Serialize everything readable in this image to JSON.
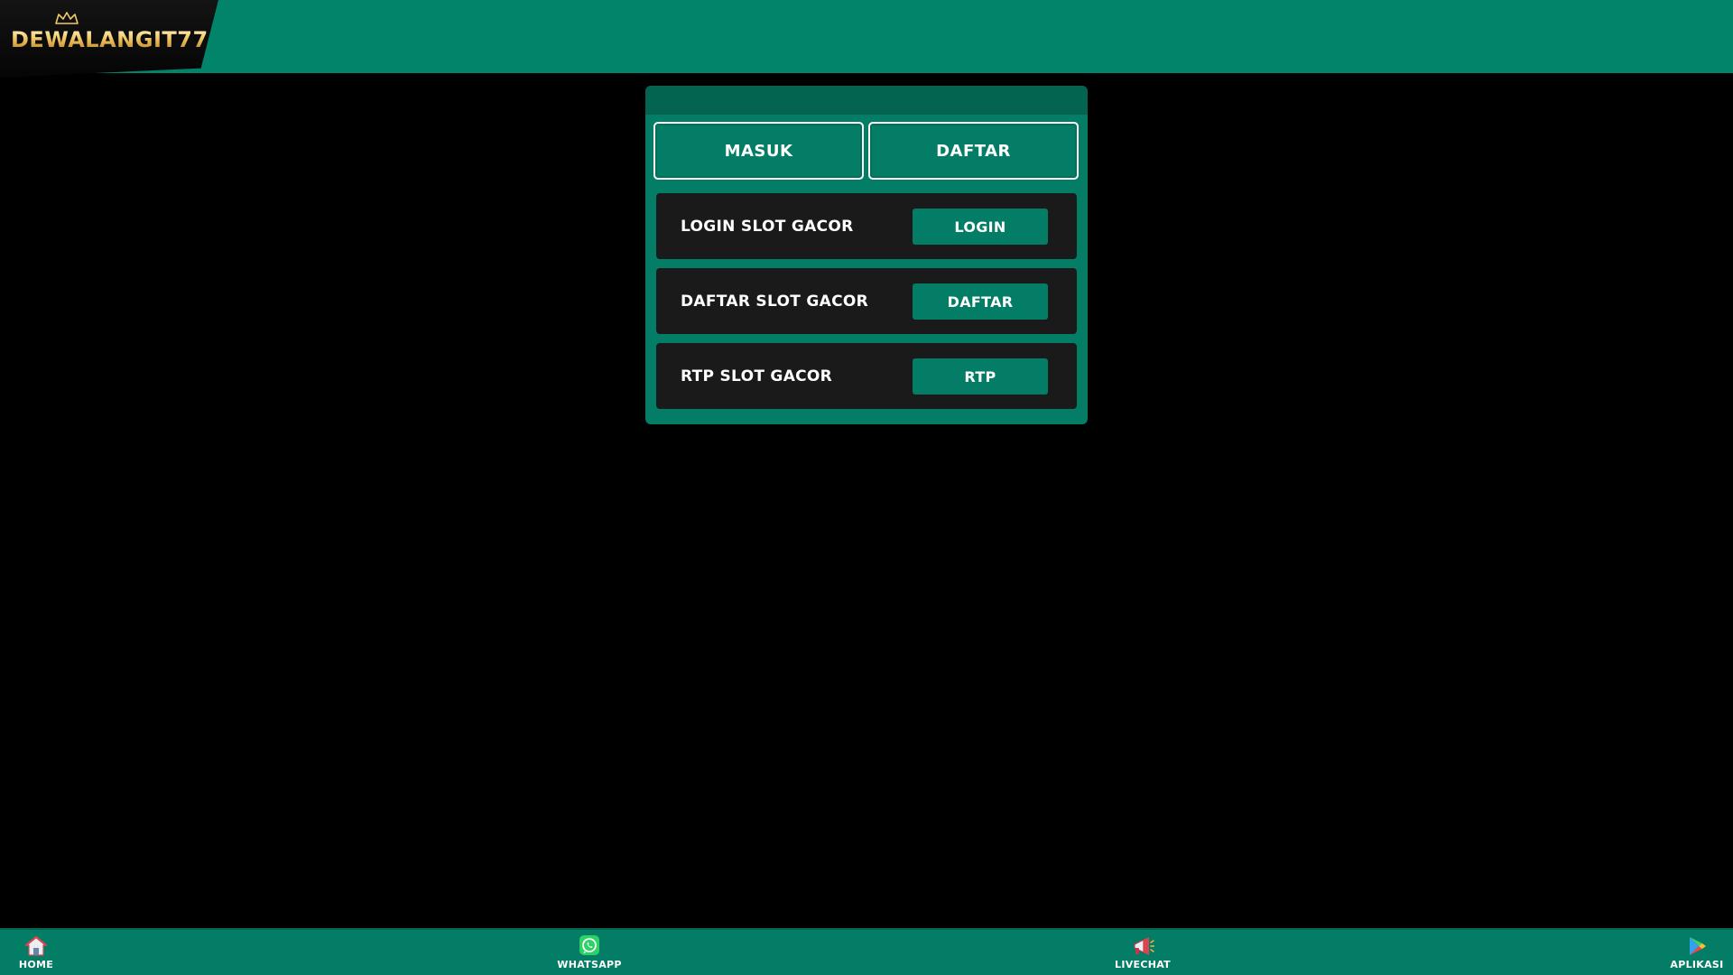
{
  "header": {
    "logo_text": "DEWALANGIT77"
  },
  "tabs": [
    {
      "label": "MASUK"
    },
    {
      "label": "DAFTAR"
    }
  ],
  "rows": [
    {
      "label": "LOGIN SLOT GACOR",
      "button": "LOGIN"
    },
    {
      "label": "DAFTAR SLOT GACOR",
      "button": "DAFTAR"
    },
    {
      "label": "RTP SLOT GACOR",
      "button": "RTP"
    }
  ],
  "bottom_nav": [
    {
      "label": "HOME",
      "icon": "home-icon"
    },
    {
      "label": "WHATSAPP",
      "icon": "whatsapp-icon"
    },
    {
      "label": "LIVECHAT",
      "icon": "megaphone-icon"
    },
    {
      "label": "APLIKASI",
      "icon": "play-store-icon"
    }
  ],
  "colors": {
    "primary_green": "#047d66",
    "header_green": "#02846b",
    "row_dark": "#1a1a1a",
    "background": "#000000",
    "logo_gold": "#f1c866"
  }
}
